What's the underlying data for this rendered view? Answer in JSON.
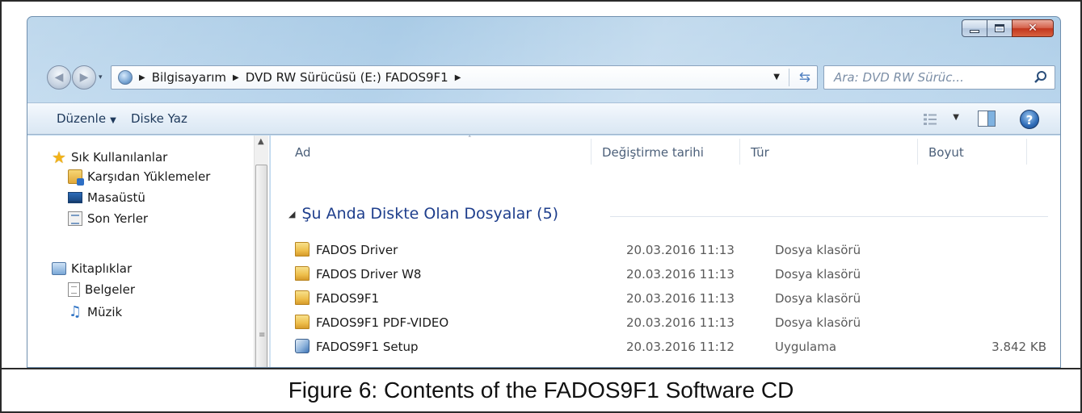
{
  "window": {
    "minimize_symbol": "–",
    "close_symbol": "✕"
  },
  "nav": {
    "back_icon": "◀",
    "forward_icon": "▶",
    "history_dropdown": "▾",
    "breadcrumb": [
      "Bilgisayarım",
      "DVD RW Sürücüsü (E:) FADOS9F1"
    ],
    "crumb_separator": "▶",
    "address_dropdown": "▼",
    "refresh_icon": "⇆"
  },
  "search": {
    "placeholder": "Ara: DVD RW Sürüc..."
  },
  "toolbar": {
    "organize_label": "Düzenle",
    "organize_caret": "▼",
    "burn_label": "Diske Yaz",
    "view_caret": "▼",
    "help_label": "?"
  },
  "sidebar": {
    "scroll_up": "▲",
    "scroll_grip": "≡",
    "items": [
      {
        "label": "Sık Kullanılanlar",
        "icon": "star-icon"
      },
      {
        "label": "Karşıdan Yüklemeler",
        "icon": "downloads-icon"
      },
      {
        "label": "Masaüstü",
        "icon": "desktop-icon"
      },
      {
        "label": "Son Yerler",
        "icon": "recent-places-icon"
      },
      {
        "label": "Kitaplıklar",
        "icon": "libraries-icon"
      },
      {
        "label": "Belgeler",
        "icon": "documents-icon"
      },
      {
        "label": "Müzik",
        "icon": "music-icon"
      }
    ]
  },
  "columns": {
    "name": "Ad",
    "date": "Değiştirme tarihi",
    "type": "Tür",
    "size": "Boyut",
    "sort_indicator": "˄"
  },
  "group": {
    "caret": "◢",
    "title": "Şu Anda Diskte Olan Dosyalar (5)"
  },
  "files": [
    {
      "name": "FADOS Driver",
      "date": "20.03.2016 11:13",
      "type": "Dosya klasörü",
      "size": "",
      "icon": "folder-icon"
    },
    {
      "name": "FADOS Driver W8",
      "date": "20.03.2016 11:13",
      "type": "Dosya klasörü",
      "size": "",
      "icon": "folder-icon"
    },
    {
      "name": "FADOS9F1",
      "date": "20.03.2016 11:13",
      "type": "Dosya klasörü",
      "size": "",
      "icon": "folder-icon"
    },
    {
      "name": "FADOS9F1 PDF-VIDEO",
      "date": "20.03.2016 11:13",
      "type": "Dosya klasörü",
      "size": "",
      "icon": "folder-icon"
    },
    {
      "name": "FADOS9F1 Setup",
      "date": "20.03.2016 11:12",
      "type": "Uygulama",
      "size": "3.842 KB",
      "icon": "application-icon"
    }
  ],
  "caption": "Figure 6: Contents of the FADOS9F1 Software CD"
}
